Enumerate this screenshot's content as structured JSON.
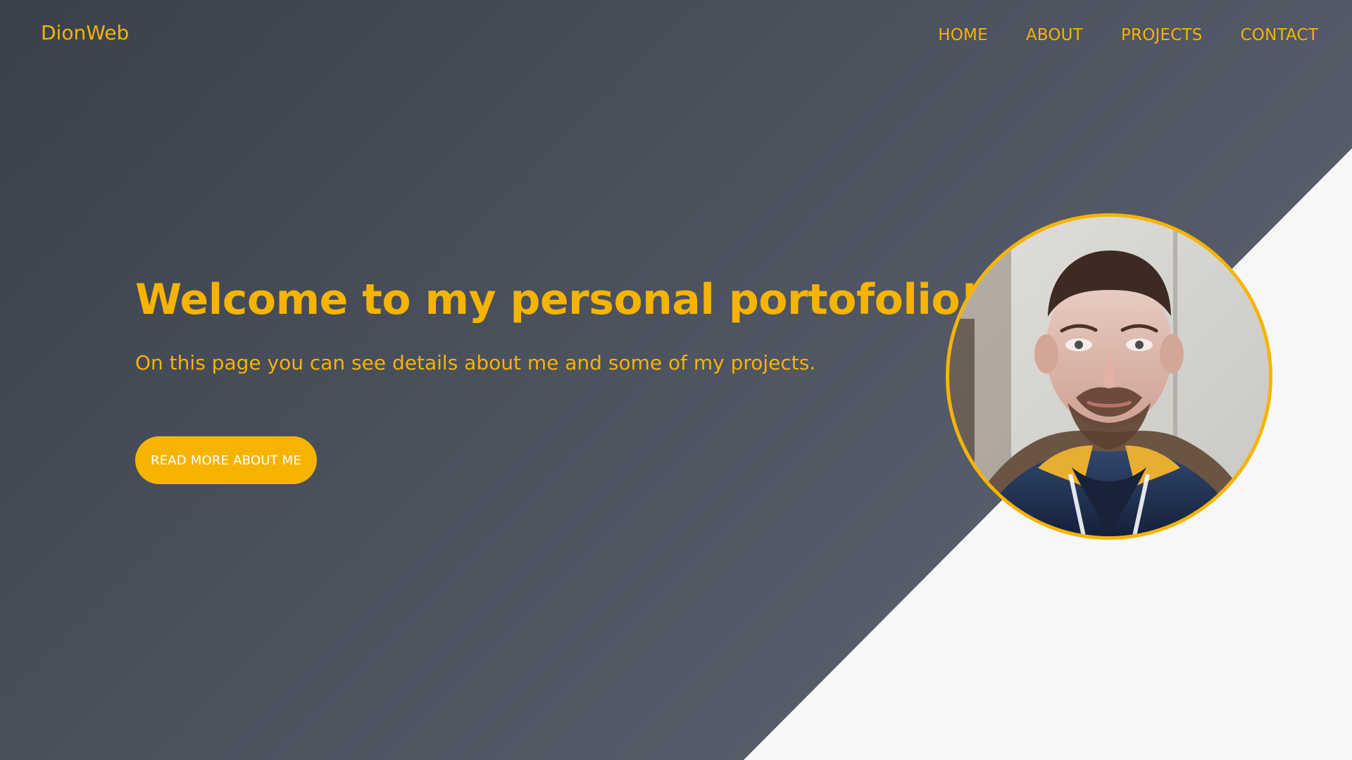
{
  "brand": {
    "name": "DionWeb"
  },
  "nav": {
    "items": [
      {
        "label": "HOME"
      },
      {
        "label": "ABOUT"
      },
      {
        "label": "PROJECTS"
      },
      {
        "label": "CONTACT"
      }
    ]
  },
  "hero": {
    "title": "Welcome to my personal portofolio!",
    "subtitle": "On this page you can see details about me and some of my projects.",
    "button_label": "READ MORE ABOUT ME"
  },
  "colors": {
    "accent": "#f6b400",
    "hero_background_start": "#3b414b",
    "hero_background_end": "#5f6571",
    "light_background": "#f7f7f7"
  },
  "icons": {
    "profile": "profile-photo"
  }
}
